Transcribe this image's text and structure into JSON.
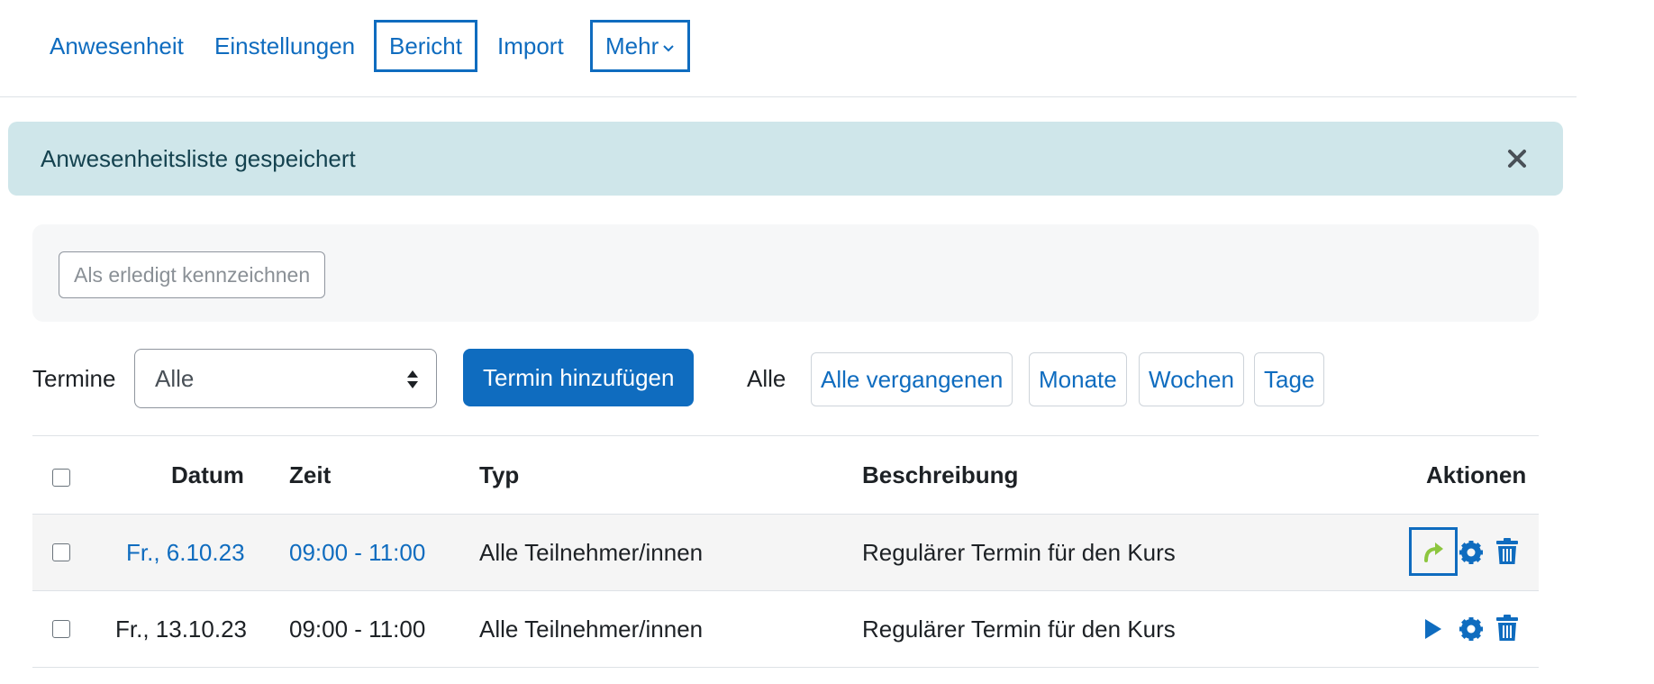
{
  "nav": {
    "tabs": [
      {
        "label": "Anwesenheit"
      },
      {
        "label": "Einstellungen"
      },
      {
        "label": "Bericht"
      },
      {
        "label": "Import"
      },
      {
        "label": "Mehr"
      }
    ]
  },
  "alert": {
    "message": "Anwesenheitsliste gespeichert",
    "close_icon": "close-icon"
  },
  "bulk": {
    "mark_done_label": "Als erledigt kennzeichnen"
  },
  "filter": {
    "label": "Termine",
    "select_value": "Alle",
    "add_button": "Termin hinzufügen",
    "all_label": "Alle",
    "views": [
      "Alle vergangenen",
      "Monate",
      "Wochen",
      "Tage"
    ]
  },
  "table": {
    "columns": [
      "Datum",
      "Zeit",
      "Typ",
      "Beschreibung",
      "Aktionen"
    ],
    "rows": [
      {
        "date": "Fr., 6.10.23",
        "time": "09:00 - 11:00",
        "type": "Alle Teilnehmer/innen",
        "description": "Regulärer Termin für den Kurs",
        "first_action_icon": "redo-arrow-icon"
      },
      {
        "date": "Fr., 13.10.23",
        "time": "09:00 - 11:00",
        "type": "Alle Teilnehmer/innen",
        "description": "Regulärer Termin für den Kurs",
        "first_action_icon": "play-icon"
      }
    ]
  },
  "colors": {
    "accent": "#0f6cbf",
    "alert_bg": "#cfe6ea",
    "redo_green": "#8dc63f"
  }
}
